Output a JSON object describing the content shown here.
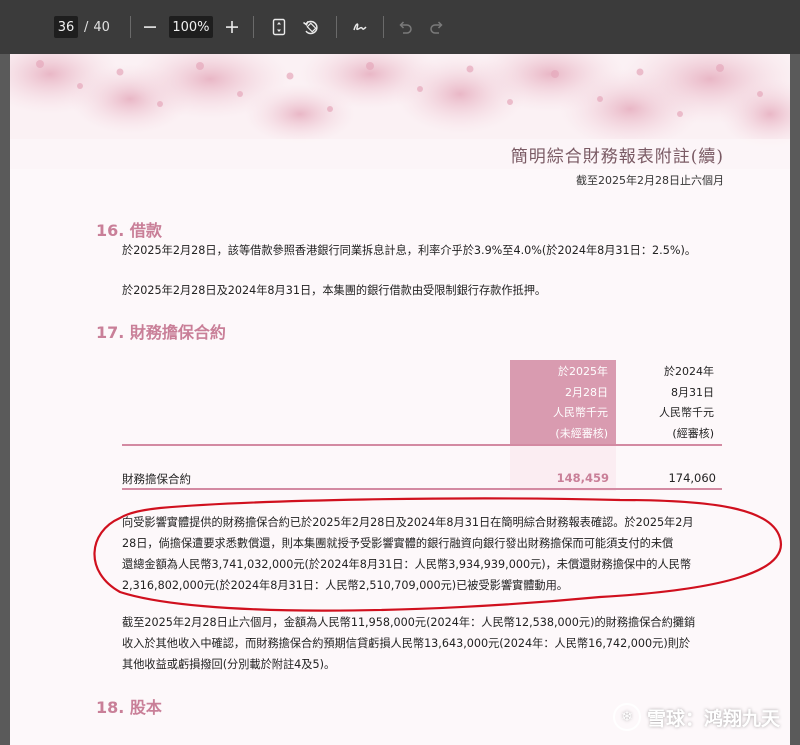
{
  "toolbar": {
    "page_current": "36",
    "page_separator": "/",
    "page_total": "40",
    "zoom_out_icon": "minus-icon",
    "zoom_value": "100%",
    "zoom_in_icon": "plus-icon",
    "fit_page_icon": "fit-page-icon",
    "rotate_icon": "rotate-icon",
    "draw_icon": "draw-icon",
    "undo_icon": "undo-icon",
    "redo_icon": "redo-icon"
  },
  "header": {
    "title": "簡明綜合財務報表附註(續)",
    "subtitle": "截至2025年2月28日止六個月"
  },
  "section16": {
    "title": "16. 借款",
    "para1": "於2025年2月28日，該等借款參照香港銀行同業拆息計息，利率介乎於3.9%至4.0%(於2024年8月31日：2.5%)。",
    "para2": "於2025年2月28日及2024年8月31日，本集團的銀行借款由受限制銀行存款作抵押。"
  },
  "section17": {
    "title": "17. 財務擔保合約",
    "col1": {
      "line1": "於2025年",
      "line2": "2月28日",
      "line3": "人民幣千元",
      "line4": "(未經審核)"
    },
    "col2": {
      "line1": "於2024年",
      "line2": "8月31日",
      "line3": "人民幣千元",
      "line4": "(經審核)"
    },
    "row_label": "財務擔保合約",
    "row_value_2025": "148,459",
    "row_value_2024": "174,060",
    "para1": [
      "向受影響實體提供的財務擔保合約已於2025年2月28日及2024年8月31日在簡明綜合財務報表確認。於2025年2月",
      "28日，倘擔保遭要求悉數償還，則本集團就授予受影響實體的銀行融資向銀行發出財務擔保而可能須支付的未償",
      "還總金額為人民幣3,741,032,000元(於2024年8月31日：人民幣3,934,939,000元)，未償還財務擔保中的人民幣",
      "2,316,802,000元(於2024年8月31日：人民幣2,510,709,000元)已被受影響實體動用。"
    ],
    "para2": [
      "截至2025年2月28日止六個月，金額為人民幣11,958,000元(2024年：人民幣12,538,000元)的財務擔保合約攤銷",
      "收入於其他收入中確認，而財務擔保合約預期信貸虧損人民幣13,643,000元(2024年：人民幣16,742,000元)則於",
      "其他收益或虧損撥回(分別載於附註4及5)。"
    ]
  },
  "section18": {
    "title": "18. 股本"
  },
  "watermark": {
    "logo_icon": "snowball-logo-icon",
    "text": "雪球：鸿翔九天"
  },
  "colors": {
    "accent_pink": "#c97f98",
    "highlight_column": "#d99bb0",
    "annotation_red": "#d0101e",
    "toolbar_bg": "#3b3b3b"
  }
}
